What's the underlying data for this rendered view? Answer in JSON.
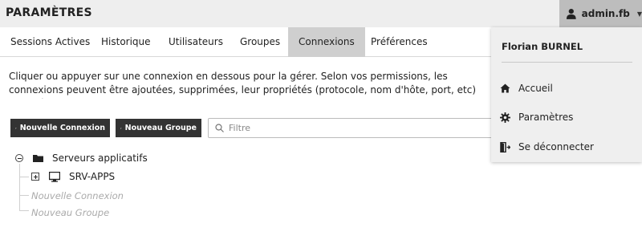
{
  "header": {
    "title": "PARAMÈTRES",
    "user": "admin.fb"
  },
  "tabs": [
    {
      "label": "Sessions Actives",
      "active": false
    },
    {
      "label": "Historique",
      "active": false
    },
    {
      "label": "Utilisateurs",
      "active": false
    },
    {
      "label": "Groupes",
      "active": false
    },
    {
      "label": "Connexions",
      "active": true
    },
    {
      "label": "Préférences",
      "active": false
    }
  ],
  "description": "Cliquer ou appuyer sur une connexion en dessous pour la gérer. Selon vos permissions, les connexions peuvent être ajoutées, supprimées, leur propriétés (protocole, nom d'hôte, port, etc) changées.",
  "toolbar": {
    "new_connection": "Nouvelle Connexion",
    "new_group": "Nouveau Groupe",
    "filter_placeholder": "Filtre"
  },
  "tree": {
    "group_label": "Serveurs applicatifs",
    "connection_label": "SRV-APPS",
    "new_connection": "Nouvelle Connexion",
    "new_group": "Nouveau Groupe"
  },
  "menu": {
    "full_name": "Florian BURNEL",
    "items": [
      {
        "label": "Accueil",
        "icon": "home-icon"
      },
      {
        "label": "Paramètres",
        "icon": "gear-icon"
      },
      {
        "label": "Se déconnecter",
        "icon": "logout-icon"
      }
    ]
  }
}
